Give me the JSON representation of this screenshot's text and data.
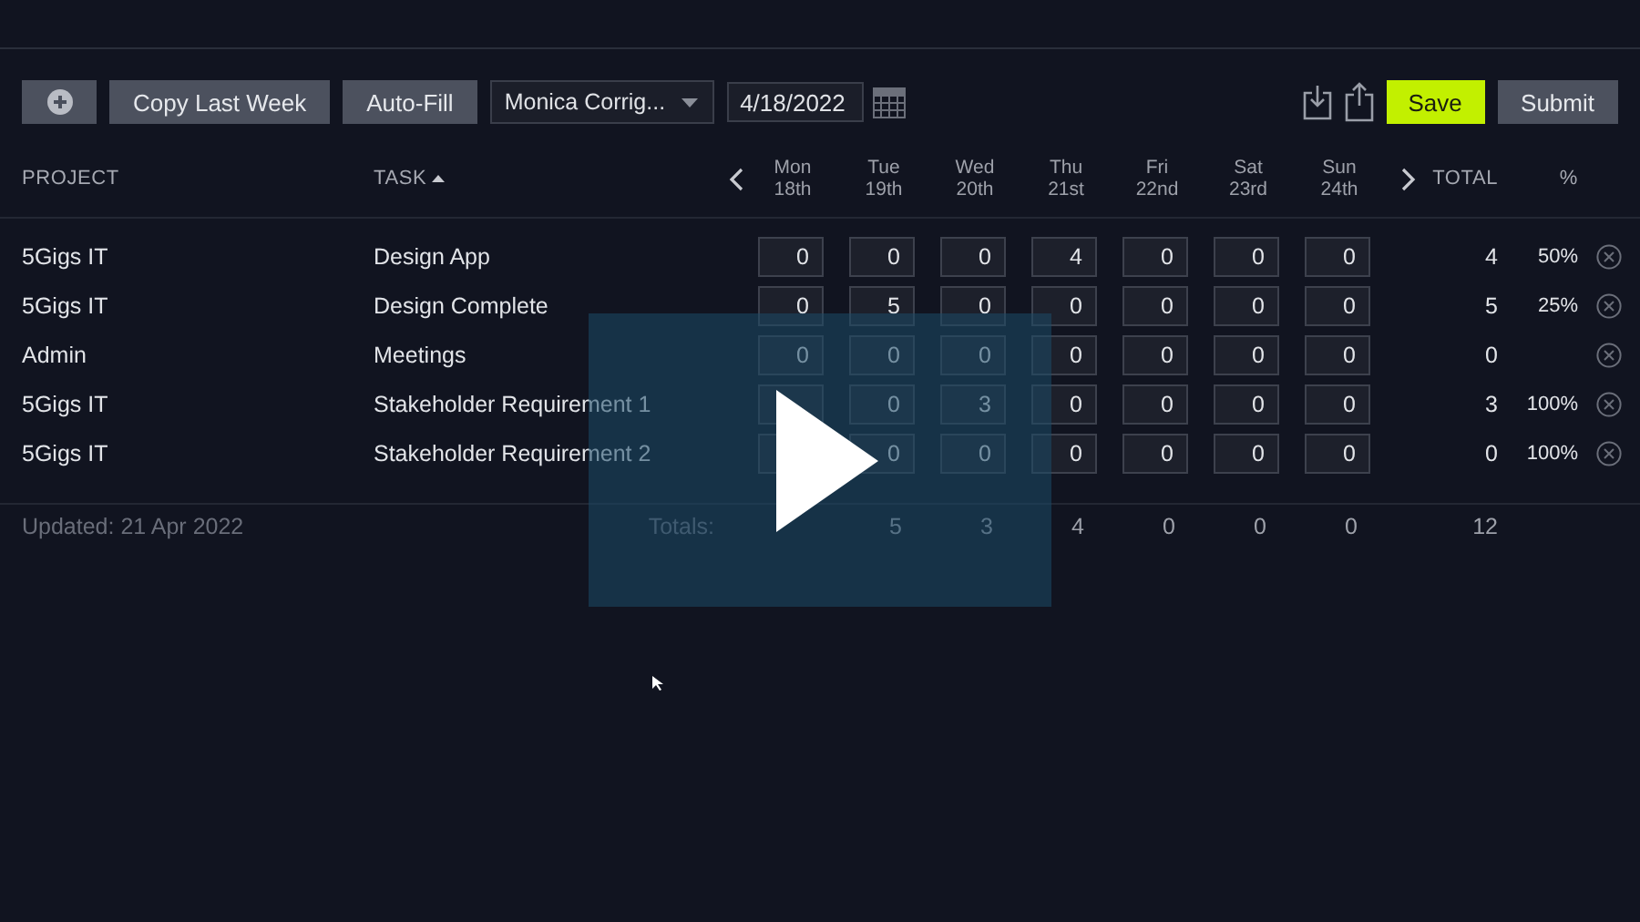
{
  "toolbar": {
    "copy_button": "Copy Last Week",
    "autofill_button": "Auto-Fill",
    "user_select": "Monica Corrig...",
    "date_field": "4/18/2022",
    "save_button": "Save",
    "submit_button": "Submit"
  },
  "table": {
    "columns": {
      "project": "PROJECT",
      "task": "TASK",
      "total": "TOTAL",
      "percent": "%"
    },
    "days": [
      {
        "day": "Mon",
        "date": "18th"
      },
      {
        "day": "Tue",
        "date": "19th"
      },
      {
        "day": "Wed",
        "date": "20th"
      },
      {
        "day": "Thu",
        "date": "21st"
      },
      {
        "day": "Fri",
        "date": "22nd"
      },
      {
        "day": "Sat",
        "date": "23rd"
      },
      {
        "day": "Sun",
        "date": "24th"
      }
    ],
    "rows": [
      {
        "project": "5Gigs IT",
        "task": "Design App",
        "hours": [
          {
            "value": "0"
          },
          {
            "value": "0"
          },
          {
            "value": "0"
          },
          {
            "value": "4"
          },
          {
            "value": "0"
          },
          {
            "value": "0"
          },
          {
            "value": "0"
          }
        ],
        "total": "4",
        "percent": "50%"
      },
      {
        "project": "5Gigs IT",
        "task": "Design Complete",
        "hours": [
          {
            "value": "0"
          },
          {
            "value": "5"
          },
          {
            "value": "0"
          },
          {
            "value": "0"
          },
          {
            "value": "0"
          },
          {
            "value": "0"
          },
          {
            "value": "0"
          }
        ],
        "total": "5",
        "percent": "25%"
      },
      {
        "project": "Admin",
        "task": "Meetings",
        "hours": [
          {
            "value": "0"
          },
          {
            "value": "0"
          },
          {
            "value": "0"
          },
          {
            "value": "0"
          },
          {
            "value": "0"
          },
          {
            "value": "0"
          },
          {
            "value": "0"
          }
        ],
        "total": "0"
      },
      {
        "project": "5Gigs IT",
        "task": "Stakeholder Requirement 1",
        "hours": [
          {
            "covered": true
          },
          {
            "value": "0"
          },
          {
            "value": "3"
          },
          {
            "value": "0"
          },
          {
            "value": "0"
          },
          {
            "value": "0"
          },
          {
            "value": "0"
          }
        ],
        "total": "3",
        "percent": "100%"
      },
      {
        "project": "5Gigs IT",
        "task": "Stakeholder Requirement 2",
        "hours": [
          {
            "covered": true
          },
          {
            "value": "0"
          },
          {
            "value": "0"
          },
          {
            "value": "0"
          },
          {
            "value": "0"
          },
          {
            "value": "0"
          },
          {
            "value": "0"
          }
        ],
        "total": "0",
        "percent": "100%"
      }
    ],
    "footer": {
      "updated": "Updated: 21 Apr 2022",
      "totals_label": "Totals:",
      "day_totals": [
        {
          "covered": true
        },
        {
          "value": "5"
        },
        {
          "value": "3"
        },
        {
          "value": "4"
        },
        {
          "value": "0"
        },
        {
          "value": "0"
        },
        {
          "value": "0"
        }
      ],
      "grand_total": "12"
    }
  }
}
